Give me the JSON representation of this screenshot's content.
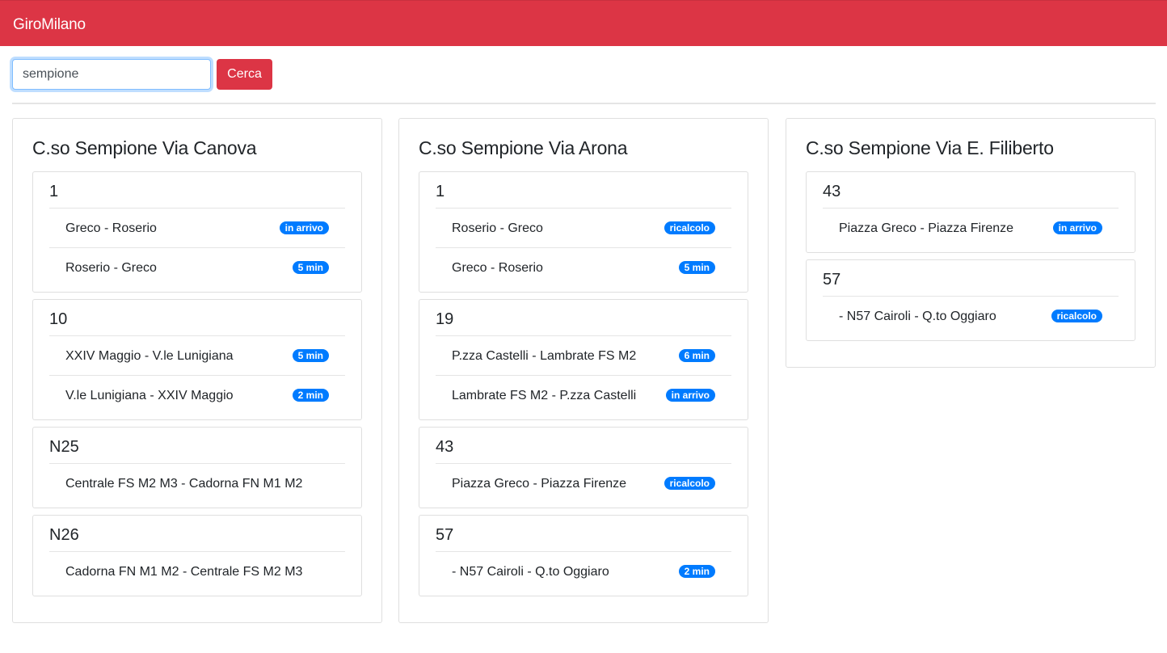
{
  "app": {
    "brand": "GiroMilano"
  },
  "search": {
    "value": "sempione",
    "button_label": "Cerca"
  },
  "stops": [
    {
      "name": "C.so Sempione Via Canova",
      "lines": [
        {
          "number": "1",
          "directions": [
            {
              "name": "Greco - Roserio",
              "status": "in arrivo"
            },
            {
              "name": "Roserio - Greco",
              "status": "5 min"
            }
          ]
        },
        {
          "number": "10",
          "directions": [
            {
              "name": "XXIV Maggio - V.le Lunigiana",
              "status": "5 min"
            },
            {
              "name": "V.le Lunigiana - XXIV Maggio",
              "status": "2 min"
            }
          ]
        },
        {
          "number": "N25",
          "directions": [
            {
              "name": "Centrale FS M2 M3 - Cadorna FN M1 M2",
              "status": ""
            }
          ]
        },
        {
          "number": "N26",
          "directions": [
            {
              "name": "Cadorna FN M1 M2 - Centrale FS M2 M3",
              "status": ""
            }
          ]
        }
      ]
    },
    {
      "name": "C.so Sempione Via Arona",
      "lines": [
        {
          "number": "1",
          "directions": [
            {
              "name": "Roserio - Greco",
              "status": "ricalcolo"
            },
            {
              "name": "Greco - Roserio",
              "status": "5 min"
            }
          ]
        },
        {
          "number": "19",
          "directions": [
            {
              "name": "P.zza Castelli - Lambrate FS M2",
              "status": "6 min"
            },
            {
              "name": "Lambrate FS M2 - P.zza Castelli",
              "status": "in arrivo"
            }
          ]
        },
        {
          "number": "43",
          "directions": [
            {
              "name": "Piazza Greco - Piazza Firenze",
              "status": "ricalcolo"
            }
          ]
        },
        {
          "number": "57",
          "directions": [
            {
              "name": "- N57 Cairoli - Q.to Oggiaro",
              "status": "2 min"
            }
          ]
        }
      ]
    },
    {
      "name": "C.so Sempione Via E. Filiberto",
      "lines": [
        {
          "number": "43",
          "directions": [
            {
              "name": "Piazza Greco - Piazza Firenze",
              "status": "in arrivo"
            }
          ]
        },
        {
          "number": "57",
          "directions": [
            {
              "name": "- N57 Cairoli - Q.to Oggiaro",
              "status": "ricalcolo"
            }
          ]
        }
      ]
    }
  ],
  "colors": {
    "navbar": "#dc3545",
    "badge": "#007bff",
    "button": "#dc3545"
  }
}
